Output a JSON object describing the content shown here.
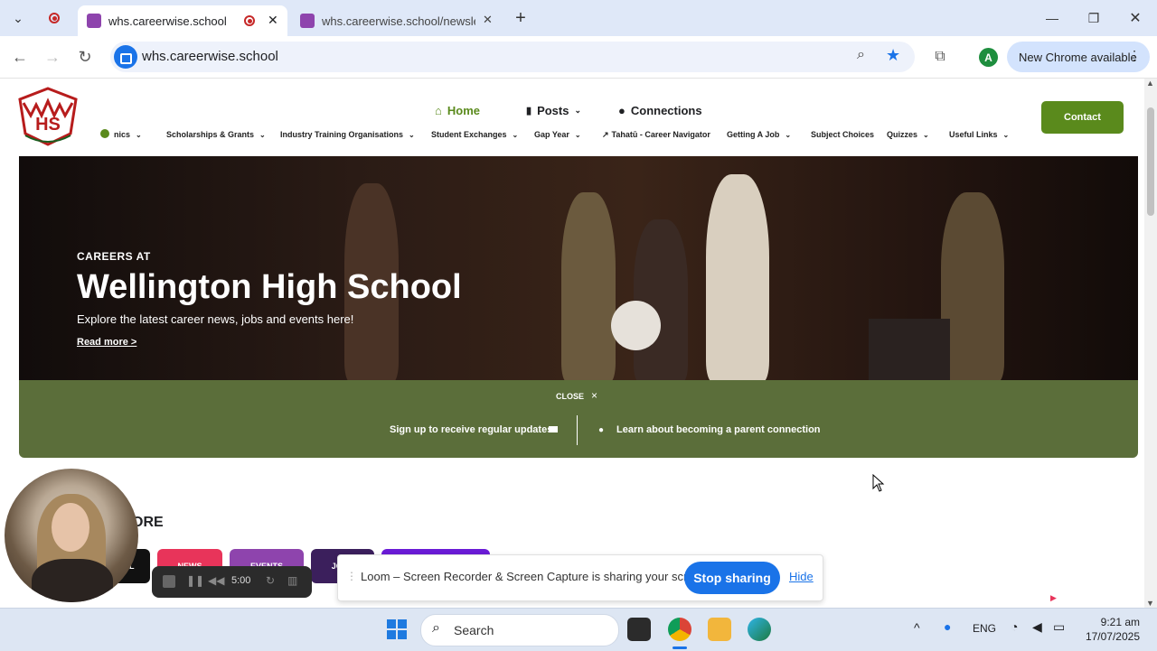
{
  "browser": {
    "tabs": [
      {
        "title": "whs.careerwise.school",
        "active": true
      },
      {
        "title": "whs.careerwise.school/newsletter",
        "active": false
      }
    ],
    "url": "whs.careerwise.school",
    "new_chrome_label": "New Chrome available",
    "avatar_letter": "A"
  },
  "site": {
    "logo_letters": "HS",
    "top_nav": [
      {
        "label": "Home",
        "active": true
      },
      {
        "label": "Posts",
        "active": false
      },
      {
        "label": "Connections",
        "active": false
      }
    ],
    "contact_label": "Contact",
    "categories": [
      "nics",
      "Scholarships & Grants",
      "Industry Training Organisations",
      "Student Exchanges",
      "Gap Year",
      "Tahatū - Career Navigator",
      "Getting A Job",
      "Subject Choices",
      "Quizzes",
      "Useful Links"
    ]
  },
  "hero": {
    "kicker": "CAREERS AT",
    "title": "Wellington High School",
    "subtitle": "Explore the latest career news, jobs and events here!",
    "read_more": "Read more >"
  },
  "signup_bar": {
    "close_label": "CLOSE",
    "close_icon": "×",
    "signup_text": "Sign up to receive regular updates",
    "parent_text": "Learn about becoming a parent connection"
  },
  "explore": {
    "title_partial": "ORE",
    "pills": [
      "LL",
      "NEWS",
      "EVENTS",
      "JOBS",
      ""
    ]
  },
  "loom": {
    "timer": "5:00",
    "share_text": "Loom – Screen Recorder & Screen Capture is sharing your screen.",
    "stop_label": "Stop sharing",
    "hide_label": "Hide"
  },
  "taskbar": {
    "search_label": "Search",
    "language": "ENG",
    "time": "9:21 am",
    "date": "17/07/2025"
  },
  "colors": {
    "brand_green": "#5a8a1c",
    "signup_bar": "#5b6e3a",
    "chrome_blue": "#1a73e8"
  }
}
